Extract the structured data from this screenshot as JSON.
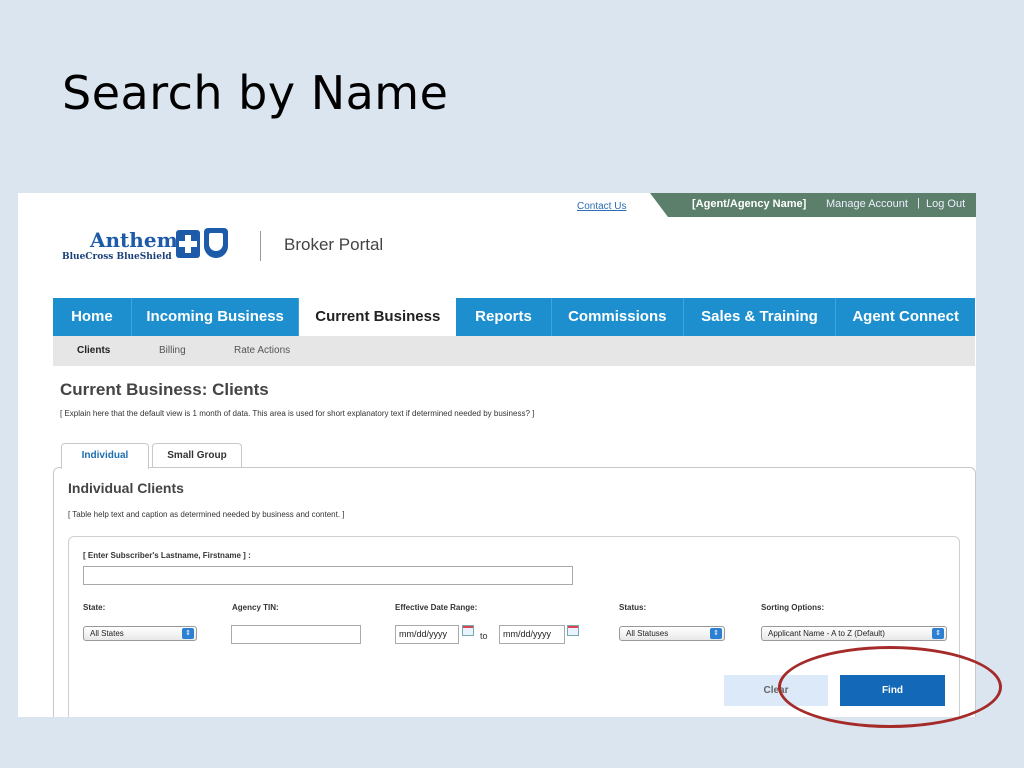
{
  "slide": {
    "title": "Search by Name"
  },
  "util": {
    "contact": "Contact Us",
    "agent": "[Agent/Agency Name]",
    "manage": "Manage Account",
    "sep": "|",
    "logout": "Log Out"
  },
  "logo": {
    "anthem": "Anthem.",
    "bcbs": "BlueCross BlueShield",
    "portal": "Broker Portal"
  },
  "nav": {
    "tabs": [
      "Home",
      "Incoming Business",
      "Current Business",
      "Reports",
      "Commissions",
      "Sales & Training",
      "Agent Connect"
    ],
    "active": "Current Business"
  },
  "subnav": {
    "items": [
      "Clients",
      "Billing",
      "Rate Actions"
    ],
    "active": "Clients"
  },
  "page": {
    "heading": "Current Business: Clients",
    "help": "[ Explain here that the default view is 1 month of data.  This area is used for short explanatory text if determined needed by business? ]"
  },
  "panel_tabs": [
    "Individual",
    "Small Group"
  ],
  "panel": {
    "heading": "Individual Clients",
    "help": "[ Table help text and caption as determined needed by business and content. ]"
  },
  "form": {
    "name_label": "[ Enter Subscriber's Lastname, Firstname ] :",
    "name_value": "",
    "state_label": "State:",
    "state_value": "All States",
    "tin_label": "Agency TIN:",
    "tin_value": "",
    "date_label": "Effective Date Range:",
    "date_from": "mm/dd/yyyy",
    "date_to_word": "to",
    "date_to": "mm/dd/yyyy",
    "status_label": "Status:",
    "status_value": "All Statuses",
    "sort_label": "Sorting Options:",
    "sort_value": "Applicant Name - A to Z (Default)"
  },
  "buttons": {
    "clear": "Clear",
    "find": "Find"
  },
  "colors": {
    "nav": "#1d8fcf",
    "find": "#1369b7",
    "annotation": "#a52a2a",
    "util_bar": "#5b7f6a"
  }
}
